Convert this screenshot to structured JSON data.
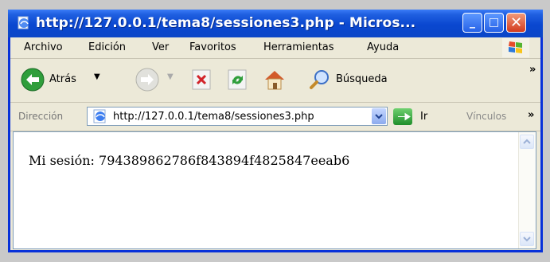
{
  "window": {
    "title": "http://127.0.0.1/tema8/sessiones3.php - Micros...",
    "buttons": {
      "minimize": "_",
      "maximize": "□",
      "close": "✕"
    }
  },
  "menu": {
    "items": [
      "Archivo",
      "Edición",
      "Ver",
      "Favoritos",
      "Herramientas",
      "Ayuda"
    ]
  },
  "toolbar": {
    "back_label": "Atrás",
    "search_label": "Búsqueda",
    "more": "»",
    "icons": [
      "back-arrow",
      "forward-arrow",
      "stop",
      "refresh",
      "home",
      "search"
    ]
  },
  "address": {
    "label": "Dirección",
    "url": "http://127.0.0.1/tema8/sessiones3.php",
    "go_label": "Ir",
    "links_label": "Vínculos",
    "more": "»"
  },
  "page": {
    "text": "Mi sesión: 794389862786f843894f4825847eeab6"
  },
  "colors": {
    "title_blue": "#0a47d0",
    "chrome_beige": "#ece9d8",
    "close_red": "#d33b1e",
    "go_green": "#1f8e2a"
  }
}
